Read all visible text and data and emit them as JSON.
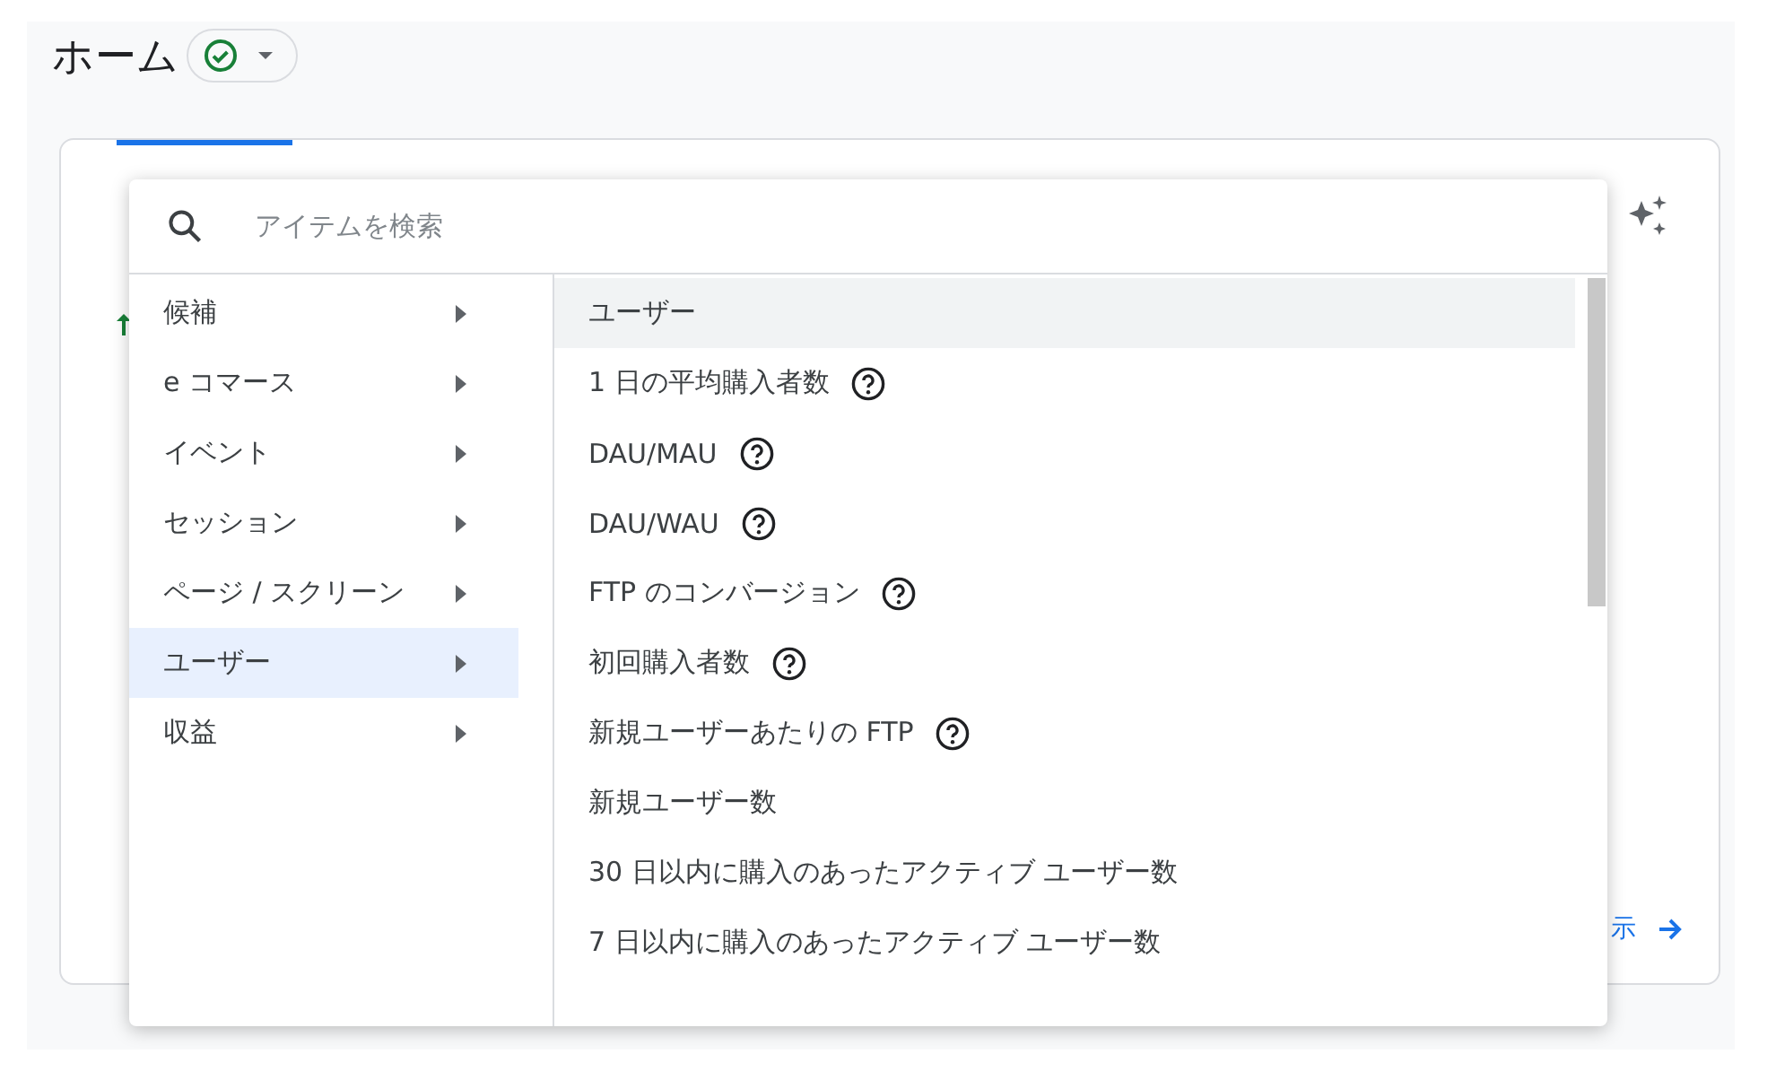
{
  "page": {
    "title": "ホーム"
  },
  "card": {
    "link": "示"
  },
  "picker": {
    "search": {
      "placeholder": "アイテムを検索"
    },
    "categories": [
      {
        "label": "候補",
        "selected": false
      },
      {
        "label": "e コマース",
        "selected": false
      },
      {
        "label": "イベント",
        "selected": false
      },
      {
        "label": "セッション",
        "selected": false
      },
      {
        "label": "ページ / スクリーン",
        "selected": false
      },
      {
        "label": "ユーザー",
        "selected": true
      },
      {
        "label": "収益",
        "selected": false
      }
    ],
    "items": [
      {
        "label": "ユーザー",
        "help": false,
        "selected": true
      },
      {
        "label": "1 日の平均購入者数",
        "help": true,
        "selected": false
      },
      {
        "label": "DAU/MAU",
        "help": true,
        "selected": false
      },
      {
        "label": "DAU/WAU",
        "help": true,
        "selected": false
      },
      {
        "label": "FTP のコンバージョン",
        "help": true,
        "selected": false
      },
      {
        "label": "初回購入者数",
        "help": true,
        "selected": false
      },
      {
        "label": "新規ユーザーあたりの FTP",
        "help": true,
        "selected": false
      },
      {
        "label": "新規ユーザー数",
        "help": false,
        "selected": false
      },
      {
        "label": "30 日以内に購入のあったアクティブ ユーザー数",
        "help": false,
        "selected": false
      },
      {
        "label": "7 日以内に購入のあったアクティブ ユーザー数",
        "help": false,
        "selected": false
      }
    ]
  }
}
